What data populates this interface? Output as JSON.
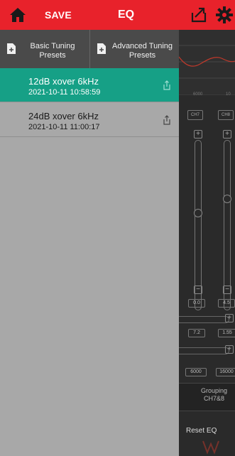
{
  "header": {
    "save_label": "SAVE",
    "title": "EQ",
    "bg_color": "#e8222b",
    "icons": [
      "home-icon",
      "export-icon",
      "gear-icon"
    ]
  },
  "drawer": {
    "tabs": [
      {
        "label": "Basic Tuning Presets",
        "icon": "add-file-icon"
      },
      {
        "label": "Advanced Tuning Presets",
        "icon": "add-file-icon"
      }
    ],
    "presets": [
      {
        "name": "12dB xover 6kHz",
        "date": "2021-10-11 10:58:59",
        "active": true,
        "icon": "share-icon"
      },
      {
        "name": "24dB xover 6kHz",
        "date": "2021-10-11 11:00:17",
        "active": false,
        "icon": "share-icon"
      }
    ],
    "active_color": "#16a086"
  },
  "eq_panel": {
    "freq_labels": [
      "6000",
      "10"
    ],
    "channels": [
      "CH7",
      "CH8"
    ],
    "gain_values": [
      "0.0",
      "4.5"
    ],
    "q_values": [
      "7.2",
      "1.55"
    ],
    "freq_values": [
      "6000",
      "16000"
    ],
    "grouping_label": "Grouping",
    "grouping_value": "CH7&8",
    "reset_label": "Reset EQ"
  }
}
